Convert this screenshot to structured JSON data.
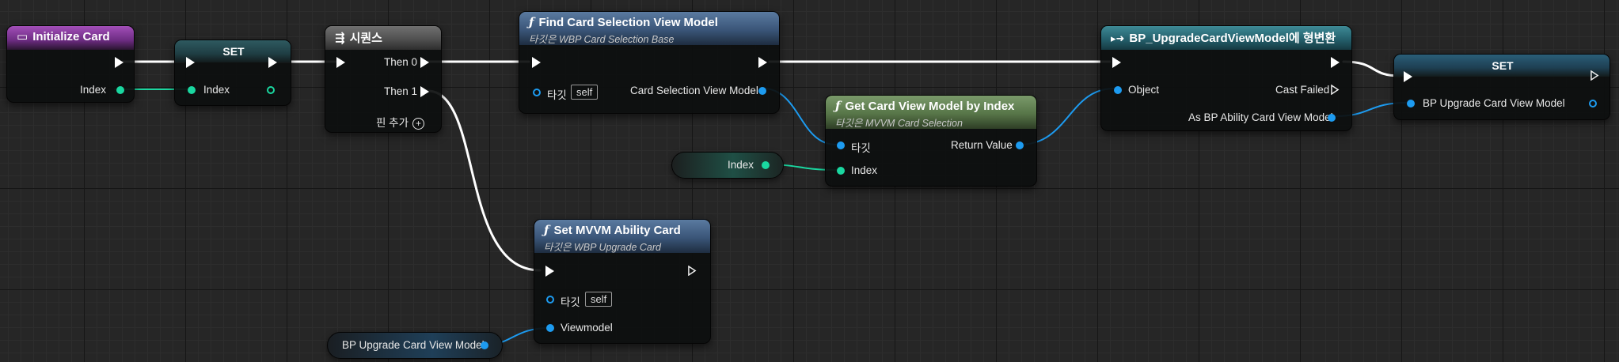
{
  "nodes": {
    "initialize_card": {
      "title": "Initialize Card",
      "index_label": "Index"
    },
    "set_index": {
      "title": "SET",
      "index_label": "Index"
    },
    "sequence": {
      "title": "시퀀스",
      "then0": "Then 0",
      "then1": "Then 1",
      "add_pin": "핀 추가"
    },
    "find_card": {
      "title": "Find Card Selection View Model",
      "subtitle": "타깃은 WBP Card Selection Base",
      "target_label": "타깃",
      "target_value": "self",
      "output_label": "Card Selection View Model"
    },
    "get_card": {
      "title": "Get Card View Model by Index",
      "subtitle": "타깃은 MVVM Card Selection",
      "target_label": "타깃",
      "index_label": "Index",
      "return_label": "Return Value"
    },
    "index_var": {
      "label": "Index"
    },
    "cast": {
      "title": "BP_UpgradeCardViewModel에 형변환",
      "object_label": "Object",
      "cast_failed": "Cast Failed",
      "output_label": "As BP Ability Card View Model"
    },
    "set_vm": {
      "title": "SET",
      "pin_label": "BP Upgrade Card View Model"
    },
    "set_mvvm": {
      "title": "Set MVVM Ability Card",
      "subtitle": "타깃은 WBP Upgrade Card",
      "target_label": "타깃",
      "target_value": "self",
      "viewmodel_label": "Viewmodel"
    },
    "vm_var": {
      "label": "BP Upgrade Card View Model"
    }
  },
  "colors": {
    "exec": "#ffffff",
    "integer": "#1ad7a0",
    "object": "#1d9bf0"
  },
  "icons": {
    "event": "event-icon",
    "function": "function-icon",
    "sequence": "sequence-icon",
    "cast": "cast-icon"
  }
}
